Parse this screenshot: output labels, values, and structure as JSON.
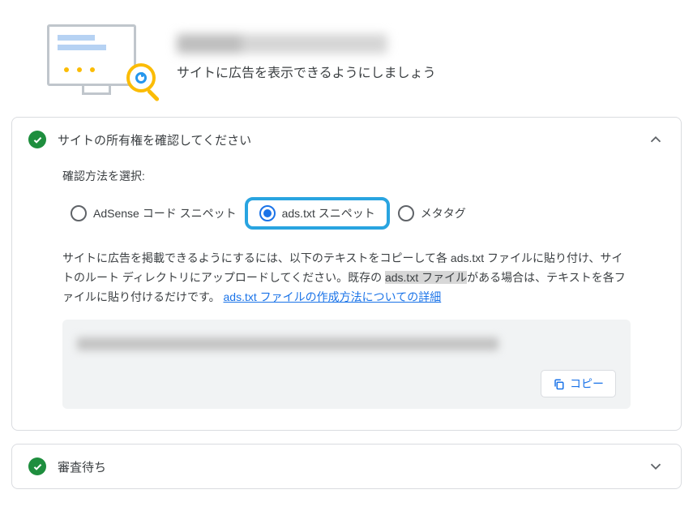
{
  "header": {
    "subtitle": "サイトに広告を表示できるようにしましょう"
  },
  "ownership_card": {
    "title": "サイトの所有権を確認してください",
    "section_label": "確認方法を選択:",
    "options": {
      "adsense": {
        "label": "AdSense コード スニペット",
        "selected": false
      },
      "adstxt": {
        "label": "ads.txt スニペット",
        "selected": true
      },
      "meta": {
        "label": "メタタグ",
        "selected": false
      }
    },
    "instruction": {
      "pre": "サイトに広告を掲載できるようにするには、以下のテキストをコピーして各 ads.txt ファイルに貼り付け、サイトのルート ディレクトリにアップロードしてください。既存の ",
      "hl": "ads.txt ファイル",
      "post": "がある場合は、テキストを各ファイルに貼り付けるだけです。 ",
      "link": "ads.txt ファイルの作成方法についての詳細"
    },
    "copy_label": "コピー"
  },
  "review_card": {
    "title": "審査待ち"
  }
}
